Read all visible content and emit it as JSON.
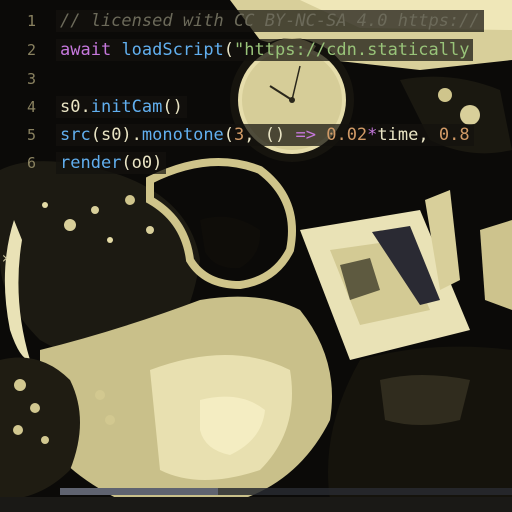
{
  "editor": {
    "lines": [
      {
        "number": "1",
        "segments": [
          {
            "cls": "tok-comment",
            "text": "// licensed with CC BY-NC-SA 4.0 https://"
          }
        ]
      },
      {
        "number": "2",
        "segments": [
          {
            "cls": "tok-keyword",
            "text": "await"
          },
          {
            "cls": "tok-plain",
            "text": " "
          },
          {
            "cls": "tok-func",
            "text": "loadScript"
          },
          {
            "cls": "tok-plain",
            "text": "("
          },
          {
            "cls": "tok-string",
            "text": "\"https://cdn.statically"
          }
        ]
      },
      {
        "number": "3",
        "segments": []
      },
      {
        "number": "4",
        "segments": [
          {
            "cls": "tok-plain",
            "text": "s0."
          },
          {
            "cls": "tok-func",
            "text": "initCam"
          },
          {
            "cls": "tok-plain",
            "text": "()"
          }
        ]
      },
      {
        "number": "5",
        "segments": [
          {
            "cls": "tok-func",
            "text": "src"
          },
          {
            "cls": "tok-plain",
            "text": "(s0)."
          },
          {
            "cls": "tok-func",
            "text": "monotone"
          },
          {
            "cls": "tok-plain",
            "text": "("
          },
          {
            "cls": "tok-number",
            "text": "3"
          },
          {
            "cls": "tok-plain",
            "text": ", () "
          },
          {
            "cls": "tok-op",
            "text": "=>"
          },
          {
            "cls": "tok-plain",
            "text": " "
          },
          {
            "cls": "tok-number",
            "text": "0.02"
          },
          {
            "cls": "tok-op",
            "text": "*"
          },
          {
            "cls": "tok-plain",
            "text": "time, "
          },
          {
            "cls": "tok-number",
            "text": "0.8"
          }
        ]
      },
      {
        "number": "6",
        "segments": [
          {
            "cls": "tok-func",
            "text": "render"
          },
          {
            "cls": "tok-plain",
            "text": "(o0)"
          }
        ]
      }
    ],
    "caret_glyph": "›"
  }
}
